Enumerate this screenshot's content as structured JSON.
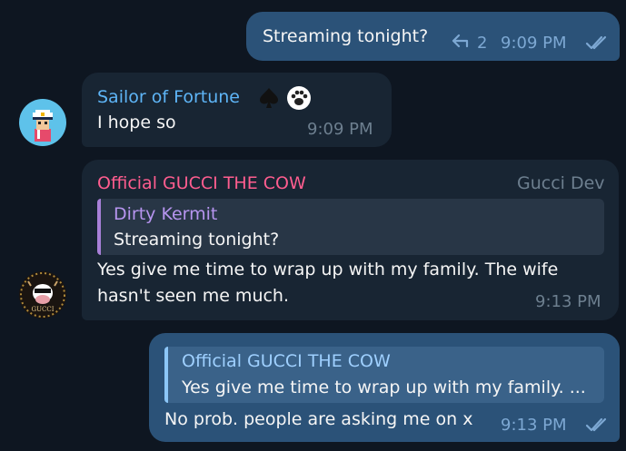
{
  "messages": {
    "m1": {
      "text": "Streaming tonight?",
      "replies_count": "2",
      "time": "9:09 PM"
    },
    "m2": {
      "sender": "Sailor of Fortune",
      "text": "I hope so",
      "time": "9:09 PM",
      "sender_color": "#5eb5f7"
    },
    "m3": {
      "sender": "Official GUCCI THE COW",
      "sender_color": "#ff5d8f",
      "badge": "Gucci Dev",
      "reply_sender": "Dirty Kermit",
      "reply_text": "Streaming tonight?",
      "text_line1": "Yes give me time to wrap up with my family.  The wife",
      "text_line2": "hasn't seen me much.",
      "time": "9:13 PM",
      "avatar_text": "GUCCI"
    },
    "m4": {
      "reply_sender": "Official GUCCI THE COW",
      "reply_text": "Yes give me time to wrap up with my family.  ...",
      "text": "No prob. people are asking me on x",
      "time": "9:13 PM"
    }
  },
  "colors": {
    "background": "#0e1621",
    "outgoing_bubble": "#2b5278",
    "incoming_bubble": "#182533",
    "accent": "#5eb5f7"
  }
}
